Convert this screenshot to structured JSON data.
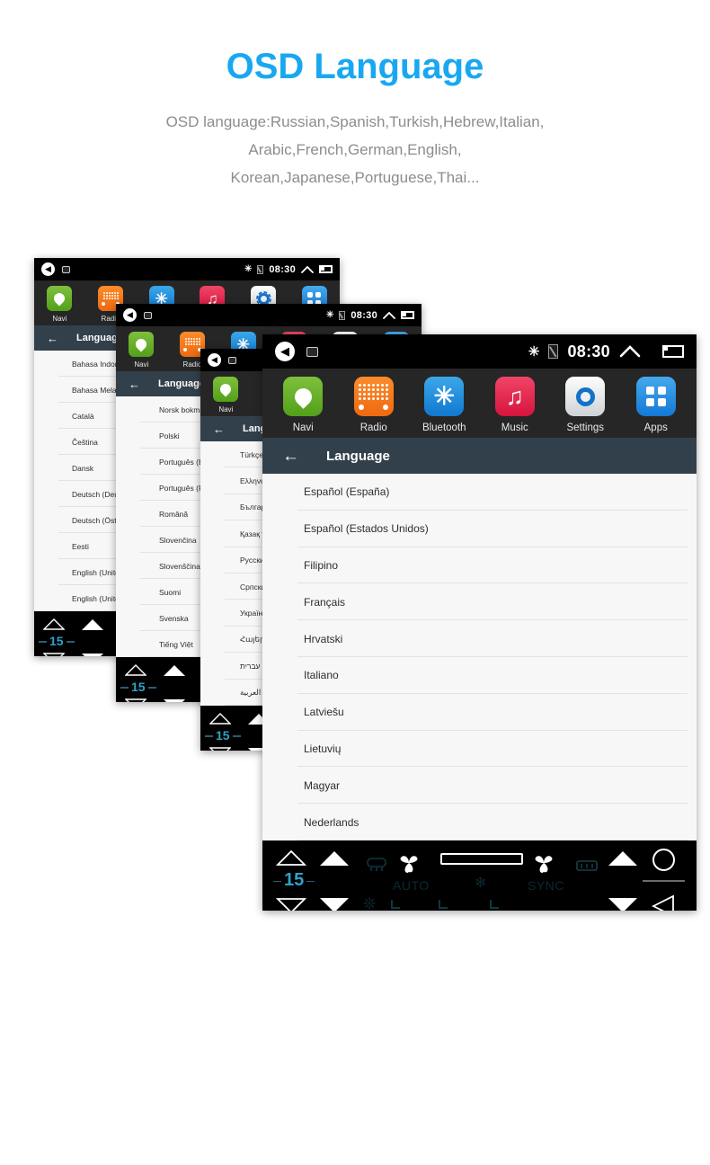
{
  "header": {
    "title": "OSD Language",
    "subtitle_lines": [
      "OSD language:Russian,Spanish,Turkish,Hebrew,Italian,",
      "Arabic,French,German,English,",
      "Korean,Japanese,Portuguese,Thai..."
    ],
    "title_color": "#19a8f0",
    "subtitle_color": "#8d8d8d"
  },
  "statusbar": {
    "clock": "08:30",
    "icons": [
      "speaker-icon",
      "screenshot-icon",
      "bluetooth-icon",
      "sim-card-off-icon",
      "chevron-up-icon",
      "recents-icon"
    ],
    "bluetooth_glyph": "✳"
  },
  "dock": {
    "items": [
      {
        "label": "Navi",
        "icon": "location-pin-icon",
        "color": "#5aa81c"
      },
      {
        "label": "Radio",
        "icon": "radio-icon",
        "color": "#ee6a10"
      },
      {
        "label": "Bluetooth",
        "icon": "bluetooth-icon",
        "color": "#1078d0"
      },
      {
        "label": "Music",
        "icon": "music-note-icon",
        "color": "#d8143f"
      },
      {
        "label": "Settings",
        "icon": "gear-icon",
        "color": "#1272c8"
      },
      {
        "label": "Apps",
        "icon": "apps-grid-icon",
        "color": "#1479d6"
      }
    ]
  },
  "titlebar": {
    "back_icon": "back-arrow-icon",
    "title": "Language"
  },
  "hvac": {
    "temperature": "15",
    "labels": {
      "auto": "AUTO",
      "sync": "SYNC"
    },
    "icons": [
      "temp-up-outline-icon",
      "temp-down-outline-icon",
      "fan-up-icon",
      "fan-down-icon",
      "rear-defrost-icon",
      "fan-left-icon",
      "snowflake-icon",
      "fan-right-icon",
      "front-defrost-icon",
      "volume-up-icon",
      "volume-down-icon",
      "power-circle-icon",
      "back-triangle-icon"
    ]
  },
  "panels": {
    "p1": {
      "languages": [
        "Bahasa Indonesia",
        "Bahasa Melayu",
        "Català",
        "Čeština",
        "Dansk",
        "Deutsch (Deutschland)",
        "Deutsch (Österreich)",
        "Eesti",
        "English (United Kingdom)",
        "English (United States)"
      ]
    },
    "p2": {
      "languages": [
        "Norsk bokmål",
        "Polski",
        "Português (Brasil)",
        "Português (Portugal)",
        "Română",
        "Slovenčina",
        "Slovenščina",
        "Suomi",
        "Svenska",
        "Tiếng Việt"
      ]
    },
    "p3": {
      "languages": [
        "Türkçe",
        "Ελληνικά",
        "Български",
        "Қазақ тілі",
        "Русский",
        "Српски",
        "Українська",
        "Հայերեն",
        "עברית",
        "العربية"
      ]
    },
    "p4": {
      "languages": [
        "Español (España)",
        "Español (Estados Unidos)",
        "Filipino",
        "Français",
        "Hrvatski",
        "Italiano",
        "Latviešu",
        "Lietuvių",
        "Magyar",
        "Nederlands"
      ]
    }
  }
}
